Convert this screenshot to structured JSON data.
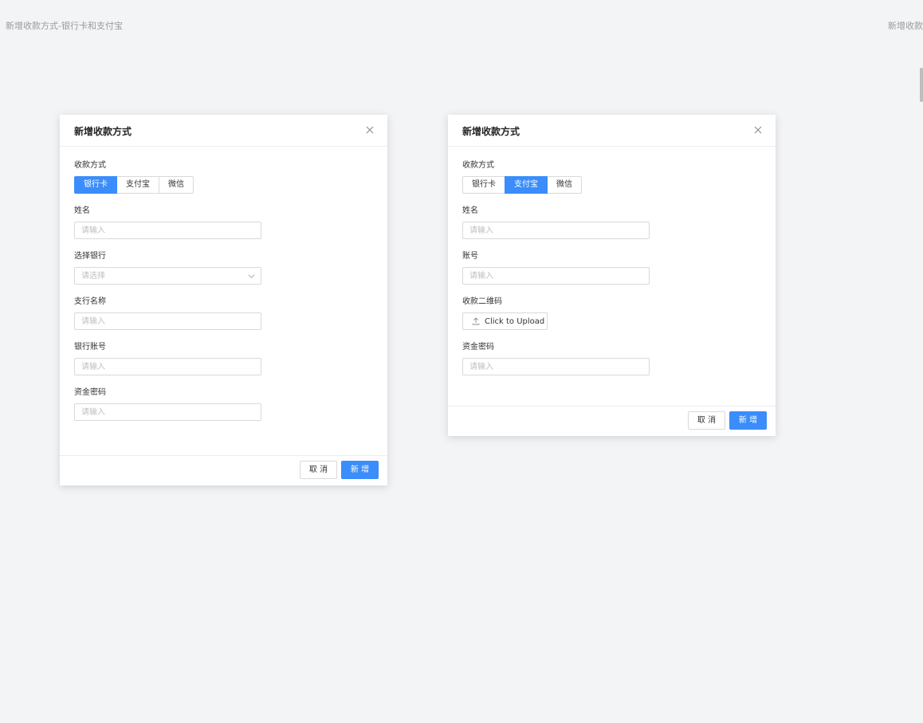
{
  "canvas": {
    "left_title": "新增收款方式-银行卡和支付宝",
    "right_title": "新增收款"
  },
  "dialog_bank": {
    "title": "新增收款方式",
    "method_label": "收款方式",
    "tabs": [
      "银行卡",
      "支付宝",
      "微信"
    ],
    "active_tab": "银行卡",
    "name_label": "姓名",
    "name_placeholder": "请输入",
    "bank_label": "选择银行",
    "bank_placeholder": "请选择",
    "branch_label": "支行名称",
    "branch_placeholder": "请输入",
    "account_label": "银行账号",
    "account_placeholder": "请输入",
    "password_label": "资金密码",
    "password_placeholder": "请输入",
    "cancel_label": "取 消",
    "submit_label": "新 增"
  },
  "dialog_alipay": {
    "title": "新增收款方式",
    "method_label": "收款方式",
    "tabs": [
      "银行卡",
      "支付宝",
      "微信"
    ],
    "active_tab": "支付宝",
    "name_label": "姓名",
    "name_placeholder": "请输入",
    "account_label": "账号",
    "account_placeholder": "请输入",
    "qrcode_label": "收款二维码",
    "upload_label": "Click to Upload",
    "password_label": "资金密码",
    "password_placeholder": "请输入",
    "cancel_label": "取 消",
    "submit_label": "新 增"
  },
  "colors": {
    "accent": "#3a8dfa",
    "background": "#f3f4f6",
    "border": "#d9d9d9",
    "placeholder": "#bfbfbf"
  },
  "icons": {
    "close": "close-icon",
    "select_arrow": "chevron-down-icon",
    "upload": "upload-icon"
  }
}
